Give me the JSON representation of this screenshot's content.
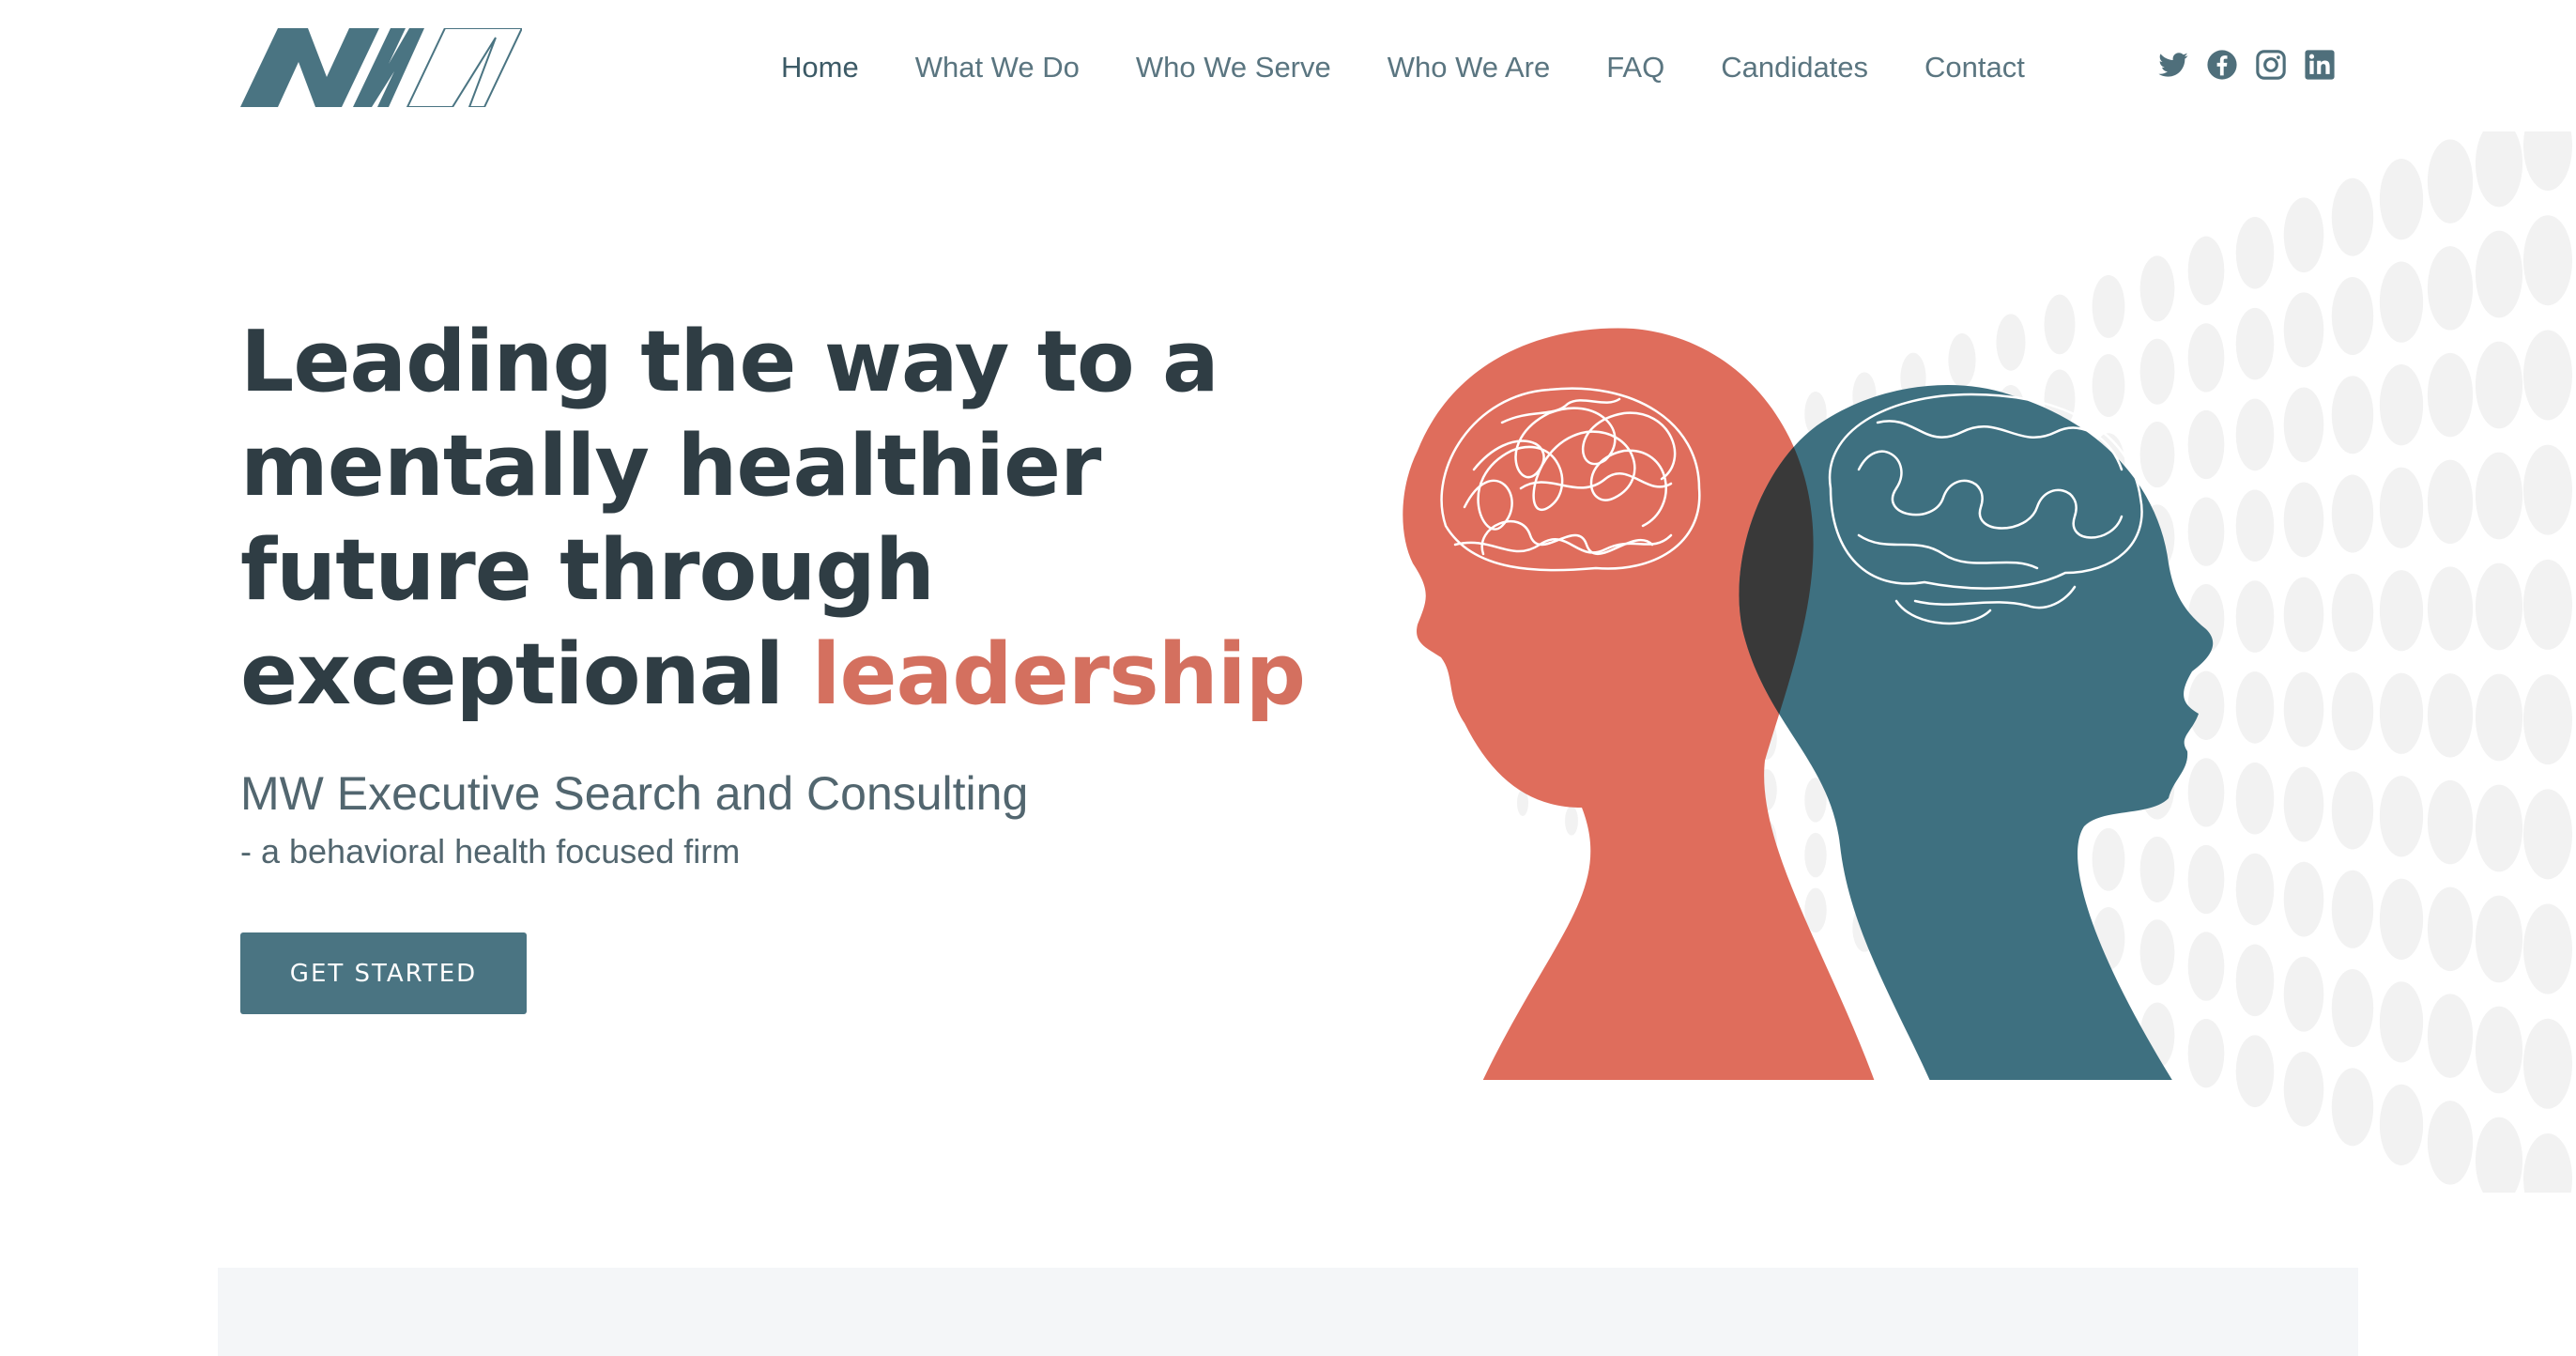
{
  "header": {
    "logo_alt": "MW",
    "nav": [
      {
        "label": "Home",
        "active": true
      },
      {
        "label": "What We Do"
      },
      {
        "label": "Who We Serve"
      },
      {
        "label": "Who We Are"
      },
      {
        "label": "FAQ"
      },
      {
        "label": "Candidates"
      },
      {
        "label": "Contact"
      }
    ],
    "social_icons": [
      "twitter-icon",
      "facebook-icon",
      "instagram-icon",
      "linkedin-icon"
    ]
  },
  "hero": {
    "title_lines": [
      "Leading the way to a",
      "mentally healthier",
      "future through",
      "exceptional "
    ],
    "title_accent": "leadership",
    "subtitle": "MW Executive Search and Consulting",
    "tagline": "- a behavioral health focused firm",
    "cta_label": "GET STARTED"
  },
  "colors": {
    "primary": "#4a7482",
    "accent": "#d4705f",
    "heading": "#2f3d44",
    "nav": "#5a7580",
    "head_left": "#df6d5c",
    "head_right": "#3e7080",
    "overlap": "#393939"
  }
}
